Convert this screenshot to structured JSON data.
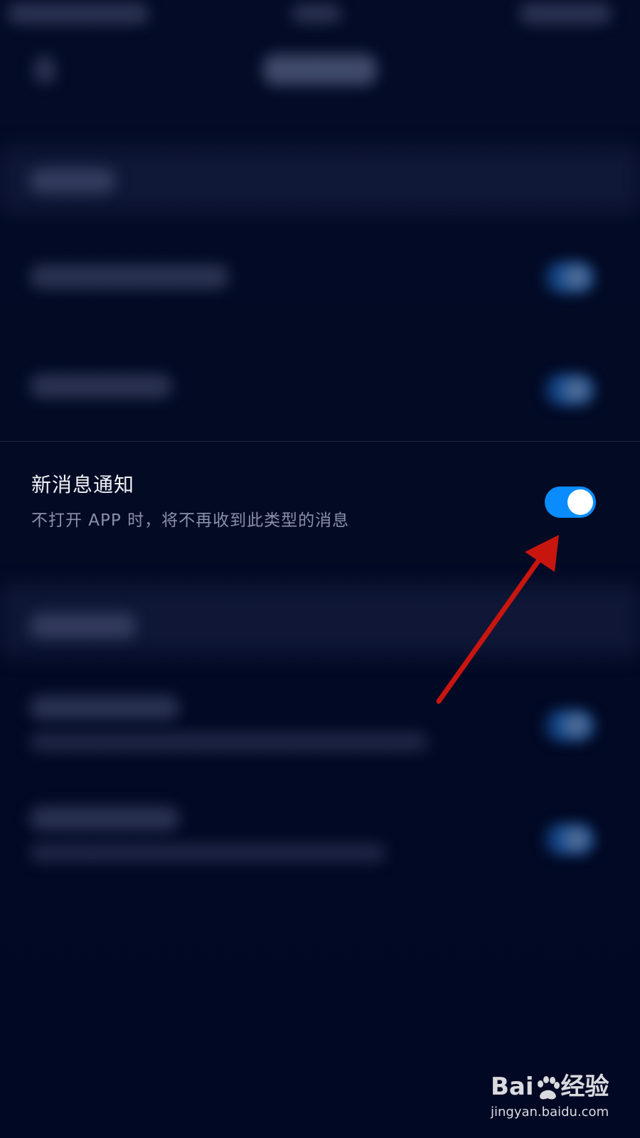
{
  "notification_setting": {
    "title": "新消息通知",
    "description": "不打开 APP 时，将不再收到此类型的消息",
    "enabled": true
  },
  "watermark": {
    "brand_left": "Bai",
    "brand_right": "经验",
    "url": "jingyan.baidu.com"
  },
  "colors": {
    "background": "#020a24",
    "toggle_on": "#0a8cff",
    "arrow": "#c8160f"
  }
}
